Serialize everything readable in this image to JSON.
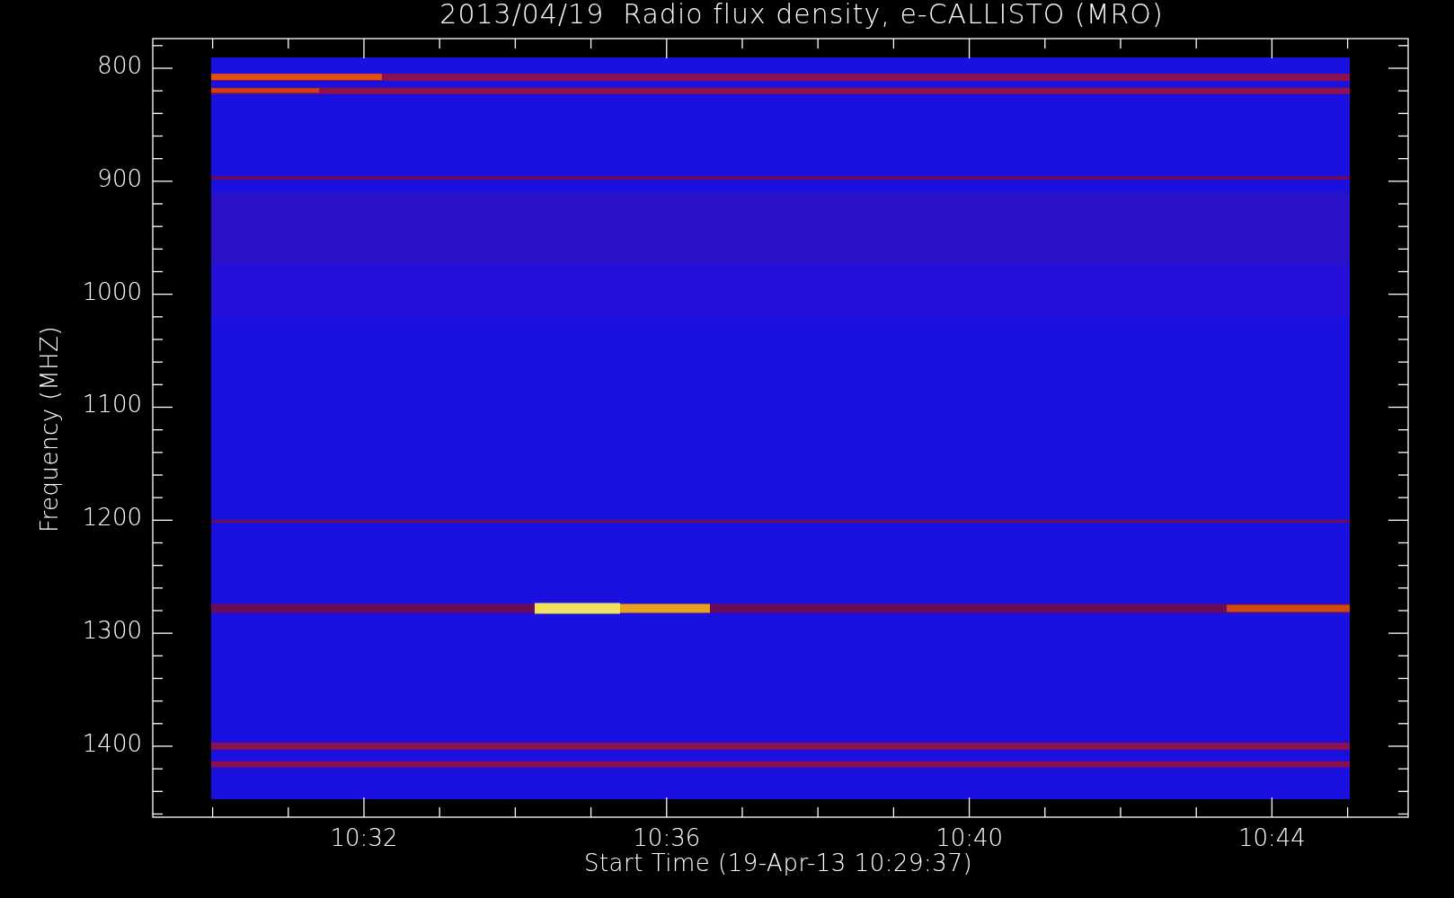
{
  "title": "2013/04/19  Radio flux density, e-CALLISTO (MRO)",
  "y_axis": {
    "label": "Frequency (MHZ)",
    "ticks": [
      "800",
      "900",
      "1000",
      "1100",
      "1200",
      "1300",
      "1400"
    ]
  },
  "x_axis": {
    "label": "Start Time (19-Apr-13 10:29:37)",
    "ticks": [
      "10:32",
      "10:36",
      "10:40",
      "10:44"
    ]
  }
}
